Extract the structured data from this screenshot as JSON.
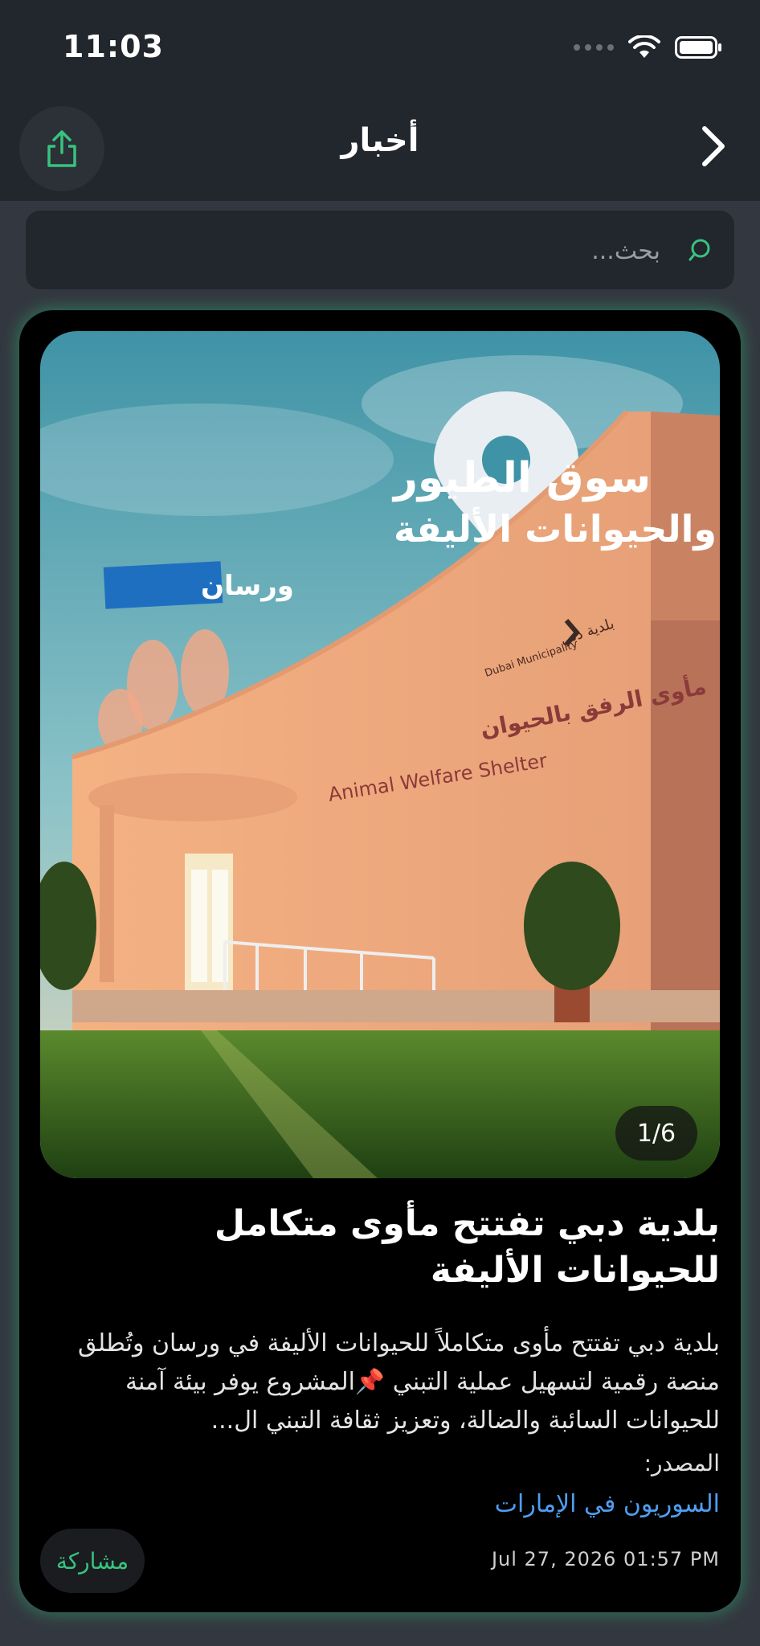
{
  "status_bar": {
    "time": "11:03"
  },
  "nav": {
    "title": "أخبار"
  },
  "search": {
    "placeholder": "بحث..."
  },
  "article": {
    "image_counter": "1/6",
    "image_text": {
      "line1": "سوق الطيور",
      "line2": "والحيوانات الأليفة",
      "badge": "ورسان",
      "sign_ar": "مأوى الرفق بالحيوان",
      "sign_en": "Animal Welfare Shelter",
      "logo_ar": "بلدية دبي",
      "logo_en": "Dubai Municipality"
    },
    "title": "بلدية دبي تفتتح مأوى متكامل للحيوانات الأليفة",
    "summary": "بلدية دبي تفتتح مأوى متكاملاً للحيوانات الأليفة في ورسان وتُطلق منصة رقمية لتسهيل عملية التبني 📌المشروع يوفر بيئة آمنة للحيوانات السائبة والضالة، وتعزيز ثقافة التبني ال...",
    "source_label": "المصدر:",
    "source_name": "السوريون في الإمارات",
    "date": "Jul 27, 2026 01:57 PM",
    "share_label": "مشاركة"
  },
  "colors": {
    "accent": "#38c37f",
    "link": "#4f9ef0",
    "background": "#333840",
    "bar": "#22262d"
  }
}
